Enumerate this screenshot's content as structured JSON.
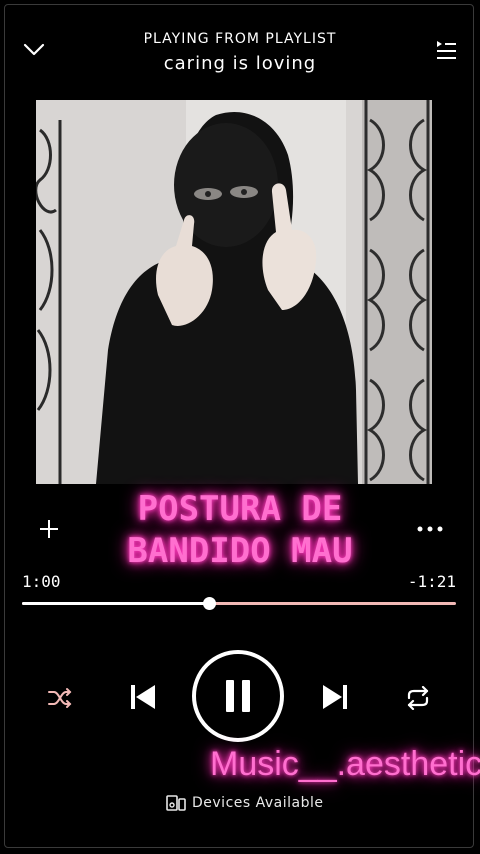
{
  "header": {
    "context_label": "PLAYING FROM PLAYLIST",
    "playlist_name": "caring is loving"
  },
  "track": {
    "title_line1": "POSTURA DE",
    "title_line2": "BANDIDO MAU",
    "elapsed": "1:00",
    "remaining": "-1:21",
    "progress_fraction": 0.43
  },
  "overlay": {
    "watermark": "Music__.aesthetic"
  },
  "footer": {
    "devices_label": "Devices Available"
  },
  "icons": {
    "collapse": "chevron-down-icon",
    "queue": "queue-icon",
    "add": "plus-icon",
    "more": "more-horizontal-icon",
    "shuffle": "shuffle-icon",
    "previous": "skip-previous-icon",
    "pause": "pause-icon",
    "next": "skip-next-icon",
    "repeat": "repeat-icon",
    "devices": "devices-icon"
  },
  "colors": {
    "background": "#000000",
    "accent_neon": "#ff6fcf",
    "progress_remaining": "#f2b9b6",
    "shuffle_tint": "#f2b9b6"
  }
}
